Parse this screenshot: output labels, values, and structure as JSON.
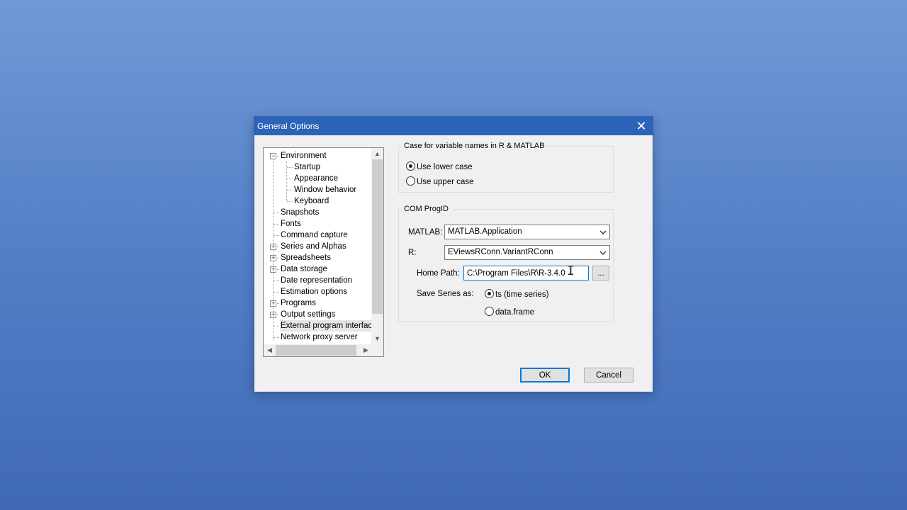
{
  "dialog": {
    "title": "General Options",
    "close_glyph": "✕"
  },
  "tree": {
    "items": [
      {
        "label": "Environment",
        "level": 0,
        "expander": "minus",
        "selected": false
      },
      {
        "label": "Startup",
        "level": 1,
        "expander": "none",
        "selected": false
      },
      {
        "label": "Appearance",
        "level": 1,
        "expander": "none",
        "selected": false
      },
      {
        "label": "Window behavior",
        "level": 1,
        "expander": "none",
        "selected": false
      },
      {
        "label": "Keyboard",
        "level": 1,
        "expander": "none",
        "selected": false
      },
      {
        "label": "Snapshots",
        "level": 0,
        "expander": "none",
        "selected": false
      },
      {
        "label": "Fonts",
        "level": 0,
        "expander": "none",
        "selected": false
      },
      {
        "label": "Command capture",
        "level": 0,
        "expander": "none",
        "selected": false
      },
      {
        "label": "Series and Alphas",
        "level": 0,
        "expander": "plus",
        "selected": false
      },
      {
        "label": "Spreadsheets",
        "level": 0,
        "expander": "plus",
        "selected": false
      },
      {
        "label": "Data storage",
        "level": 0,
        "expander": "plus",
        "selected": false
      },
      {
        "label": "Date representation",
        "level": 0,
        "expander": "none",
        "selected": false
      },
      {
        "label": "Estimation options",
        "level": 0,
        "expander": "none",
        "selected": false
      },
      {
        "label": "Programs",
        "level": 0,
        "expander": "plus",
        "selected": false
      },
      {
        "label": "Output settings",
        "level": 0,
        "expander": "plus",
        "selected": false
      },
      {
        "label": "External program interface",
        "level": 0,
        "expander": "none",
        "selected": true
      },
      {
        "label": "Network proxy server",
        "level": 0,
        "expander": "none",
        "selected": false
      }
    ],
    "scroll_up": "▲",
    "scroll_down": "▼",
    "scroll_left": "◀",
    "scroll_right": "▶"
  },
  "case_group": {
    "legend": "Case for variable names in R & MATLAB",
    "options": [
      {
        "label": "Use lower case",
        "checked": true
      },
      {
        "label": "Use upper case",
        "checked": false
      }
    ]
  },
  "com_group": {
    "legend": "COM ProgID",
    "matlab_label": "MATLAB:",
    "matlab_value": "MATLAB.Application",
    "r_label": "R:",
    "r_value": "EViewsRConn.VariantRConn",
    "home_path_label": "Home Path:",
    "home_path_value": "C:\\Program Files\\R\\R-3.4.0",
    "browse_label": "...",
    "save_series_label": "Save Series as:",
    "save_options": [
      {
        "label": "ts (time series)",
        "checked": true
      },
      {
        "label": "data.frame",
        "checked": false
      }
    ]
  },
  "buttons": {
    "ok": "OK",
    "cancel": "Cancel"
  }
}
